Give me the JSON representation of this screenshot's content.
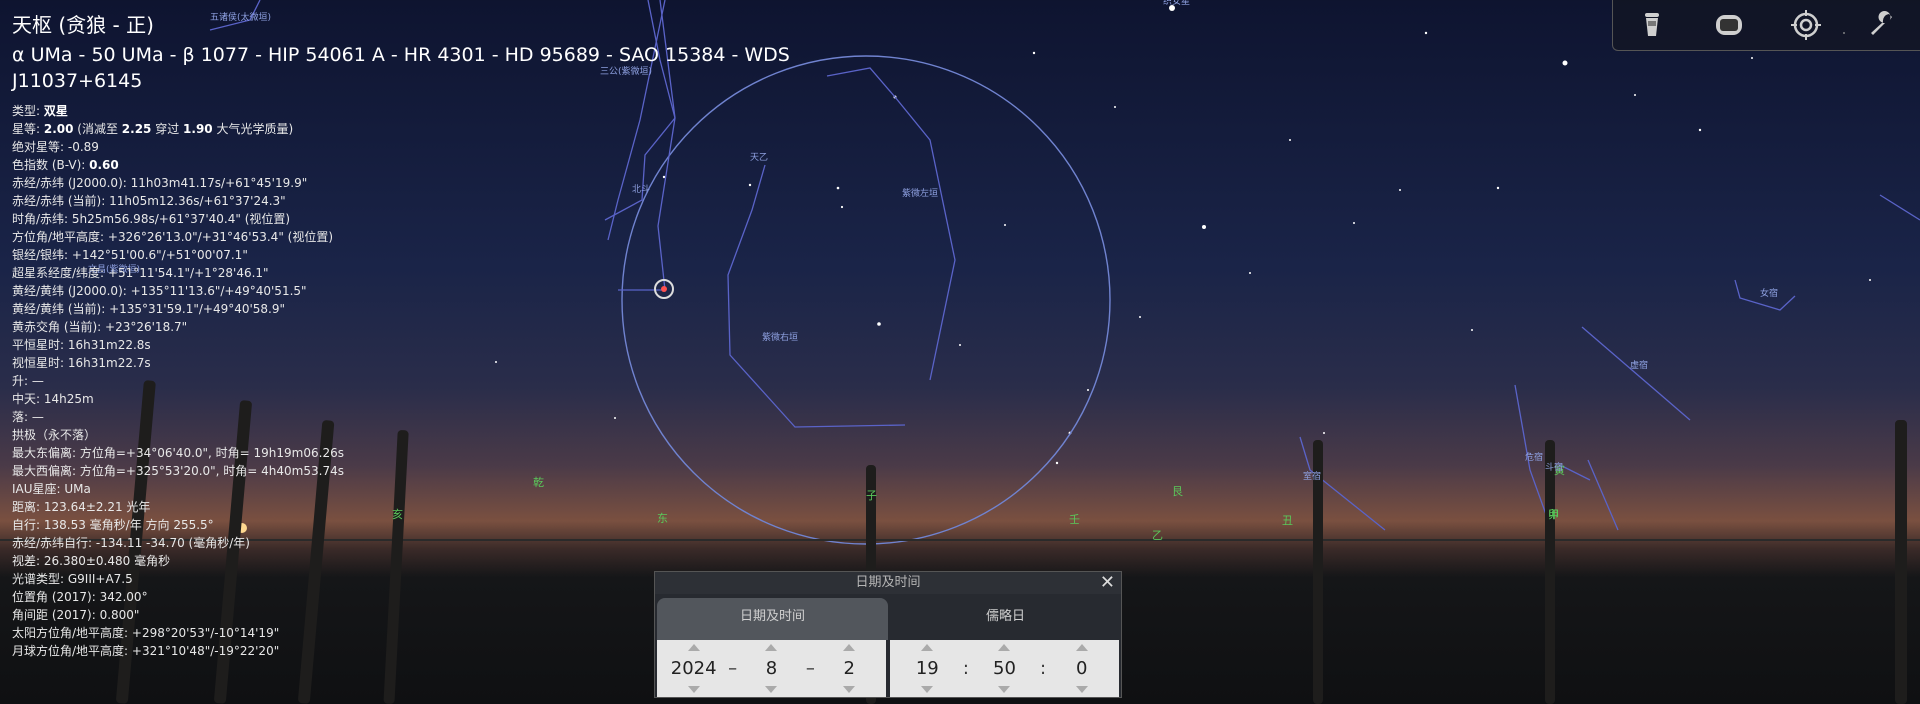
{
  "info": {
    "title": "天枢 (贪狼 - 正)",
    "ids": "α UMa - 50 UMa - β 1077 - HIP 54061 A - HR 4301 - HD 95689 - SAO 15384 - WDS J11037+6145",
    "rows": [
      "类型: <b>双星</b>",
      "星等: <b>2.00</b> (消减至 <b>2.25</b> 穿过 <b>1.90</b> 大气光学质量)",
      "绝对星等: -0.89",
      "色指数 (B-V): <b>0.60</b>",
      "赤经/赤纬 (J2000.0): 11h03m41.17s/+61°45'19.9\"",
      "赤经/赤纬 (当前): 11h05m12.36s/+61°37'24.3\"",
      "时角/赤纬: 5h25m56.98s/+61°37'40.4\" (视位置)",
      "方位角/地平高度: +326°26'13.0\"/+31°46'53.4\" (视位置)",
      "银经/银纬: +142°51'00.6\"/+51°00'07.1\"",
      "超星系经度/纬度: +51°11'54.1\"/+1°28'46.1\"",
      "黄经/黄纬 (J2000.0): +135°11'13.6\"/+49°40'51.5\"",
      "黄经/黄纬 (当前): +135°31'59.1\"/+49°40'58.9\"",
      "黄赤交角 (当前): +23°26'18.7\"",
      "平恒星时: 16h31m22.8s",
      "视恒星时: 16h31m22.7s",
      "升: —",
      "中天: 14h25m",
      "落: —",
      "拱极（永不落）",
      "最大东偏离: 方位角=+34°06'40.0\", 时角= 19h19m06.26s",
      "最大西偏离: 方位角=+325°53'20.0\", 时角= 4h40m53.74s",
      "IAU星座: UMa",
      "距离: 123.64±2.21 光年",
      "自行: 138.53 毫角秒/年 方向 255.5°",
      "赤经/赤纬自行: -134.11 -34.70 (毫角秒/年)",
      "视差: 26.380±0.480 毫角秒",
      "光谱类型: G9III+A7.5",
      "位置角 (2017): 342.00°",
      "角间距 (2017): 0.800\"",
      "太阳方位角/地平高度: +298°20'53\"/-10°14'19\"",
      "月球方位角/地平高度: +321°10'48\"/-19°22'20\""
    ]
  },
  "sky_labels": [
    {
      "text": "五诸侯(太微垣)"
    },
    {
      "text": "三公(紫微垣)"
    },
    {
      "text": "北斗"
    },
    {
      "text": "天乙"
    },
    {
      "text": "紫微左垣"
    },
    {
      "text": "紫微右垣"
    },
    {
      "text": "文昌(紫微垣)"
    },
    {
      "text": "女宿"
    },
    {
      "text": "虚宿"
    },
    {
      "text": "室宿"
    },
    {
      "text": "危宿"
    },
    {
      "text": "斗宿"
    },
    {
      "text": "织女星"
    }
  ],
  "compass": [
    "乾",
    "亥",
    "子",
    "壬",
    "丑",
    "寅",
    "艮",
    "甲",
    "东",
    "卯",
    "乙"
  ],
  "toolbar": {
    "icons": [
      "lantern-icon",
      "screen-icon",
      "target-icon",
      "wrench-icon"
    ]
  },
  "dialog": {
    "title": "日期及时间",
    "close": "✕",
    "tab_date": "日期及时间",
    "tab_jd": "儒略日",
    "year": "2024",
    "month": "8",
    "day": "2",
    "hour": "19",
    "minute": "50",
    "second": "0",
    "date_sep": "–",
    "time_sep": ":"
  }
}
